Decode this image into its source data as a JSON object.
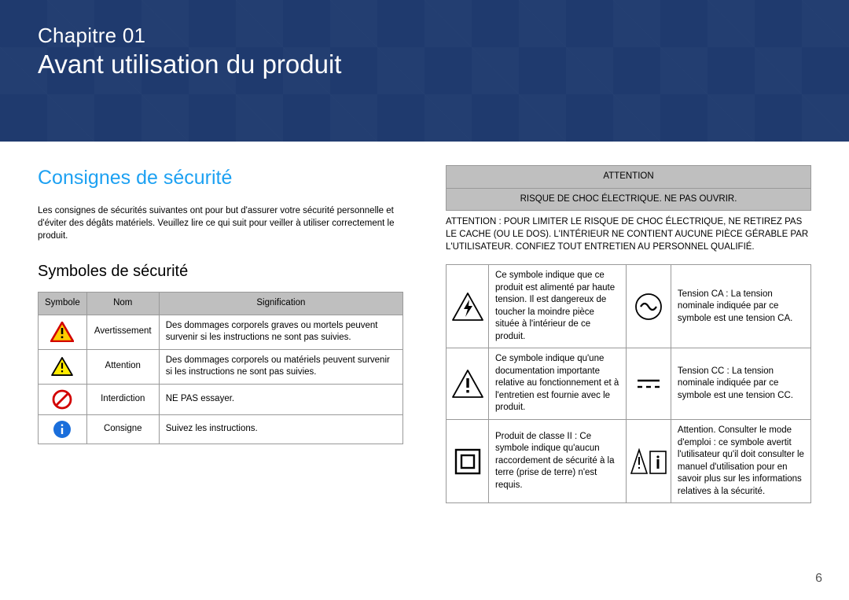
{
  "header": {
    "chapter_num": "Chapitre 01",
    "chapter_title": "Avant utilisation du produit"
  },
  "section": {
    "title": "Consignes de sécurité",
    "intro": "Les consignes de sécurités suivantes ont pour but d'assurer votre sécurité personnelle et d'éviter des dégâts matériels. Veuillez lire ce qui suit pour veiller à utiliser correctement le produit.",
    "subsection_title": "Symboles de sécurité"
  },
  "symbols_table": {
    "headers": {
      "symbol": "Symbole",
      "name": "Nom",
      "meaning": "Signification"
    },
    "rows": [
      {
        "name": "Avertissement",
        "meaning": "Des dommages corporels graves ou mortels peuvent survenir si les instructions ne sont pas suivies."
      },
      {
        "name": "Attention",
        "meaning": "Des dommages corporels ou matériels peuvent survenir si les instructions ne sont pas suivies."
      },
      {
        "name": "Interdiction",
        "meaning": "NE PAS essayer."
      },
      {
        "name": "Consigne",
        "meaning": "Suivez les instructions."
      }
    ]
  },
  "attention_box": {
    "header1": "ATTENTION",
    "header2": "RISQUE DE CHOC ÉLECTRIQUE. NE PAS OUVRIR.",
    "note": "ATTENTION : POUR LIMITER LE RISQUE DE CHOC ÉLECTRIQUE, NE RETIREZ PAS LE CACHE (OU LE DOS). L'INTÉRIEUR NE CONTIENT AUCUNE PIÈCE GÉRABLE PAR L'UTILISATEUR. CONFIEZ TOUT ENTRETIEN AU PERSONNEL QUALIFIÉ.",
    "rows": [
      {
        "left": "Ce symbole indique que ce produit est alimenté par haute tension. Il est dangereux de toucher la moindre pièce située à l'intérieur de ce produit.",
        "right": "Tension CA : La tension nominale indiquée par ce symbole est une tension CA."
      },
      {
        "left": "Ce symbole indique qu'une documentation importante relative au fonctionnement et à l'entretien est fournie avec le produit.",
        "right": "Tension CC : La tension nominale indiquée par ce symbole est une tension CC."
      },
      {
        "left": "Produit de classe II : Ce symbole indique qu'aucun raccordement de sécurité à la terre (prise de terre) n'est requis.",
        "right": "Attention. Consulter le mode d'emploi : ce symbole avertit l'utilisateur qu'il doit consulter le manuel d'utilisation pour en savoir plus sur les informations relatives à la sécurité."
      }
    ]
  },
  "page_number": "6"
}
